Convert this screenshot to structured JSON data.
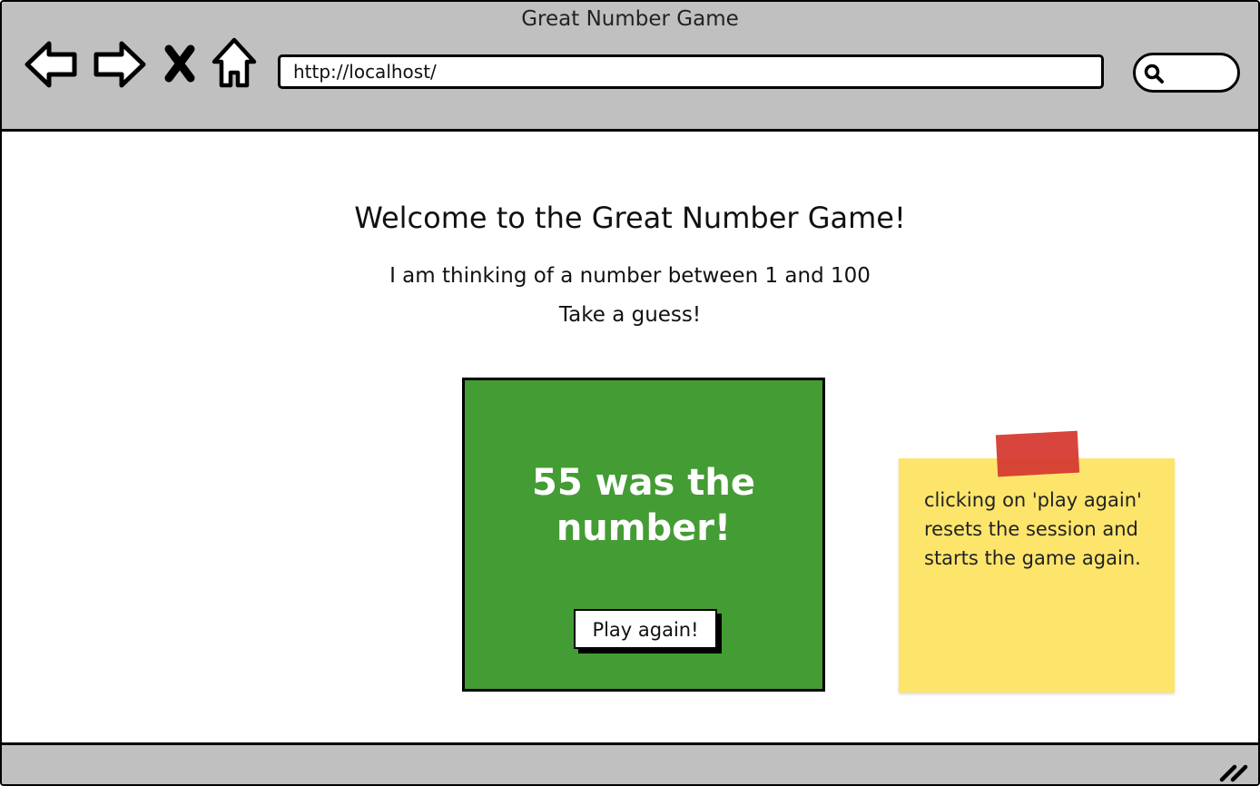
{
  "window": {
    "title": "Great Number Game"
  },
  "toolbar": {
    "back_icon": "arrow-left-icon",
    "forward_icon": "arrow-right-icon",
    "stop_icon": "close-icon",
    "home_icon": "home-icon",
    "search_icon": "search-icon"
  },
  "address_bar": {
    "url": "http://localhost/"
  },
  "page": {
    "heading": "Welcome to the Great Number Game!",
    "intro_line": "I am thinking of a number between 1 and 100",
    "prompt_line": "Take a guess!"
  },
  "result": {
    "message": "55 was the number!",
    "panel_color": "#449c34",
    "play_again_label": "Play again!"
  },
  "annotation": {
    "note_text": "clicking on 'play again' resets the session and starts the game again.",
    "note_color": "#fde56c",
    "tape_color": "#d63b32"
  }
}
